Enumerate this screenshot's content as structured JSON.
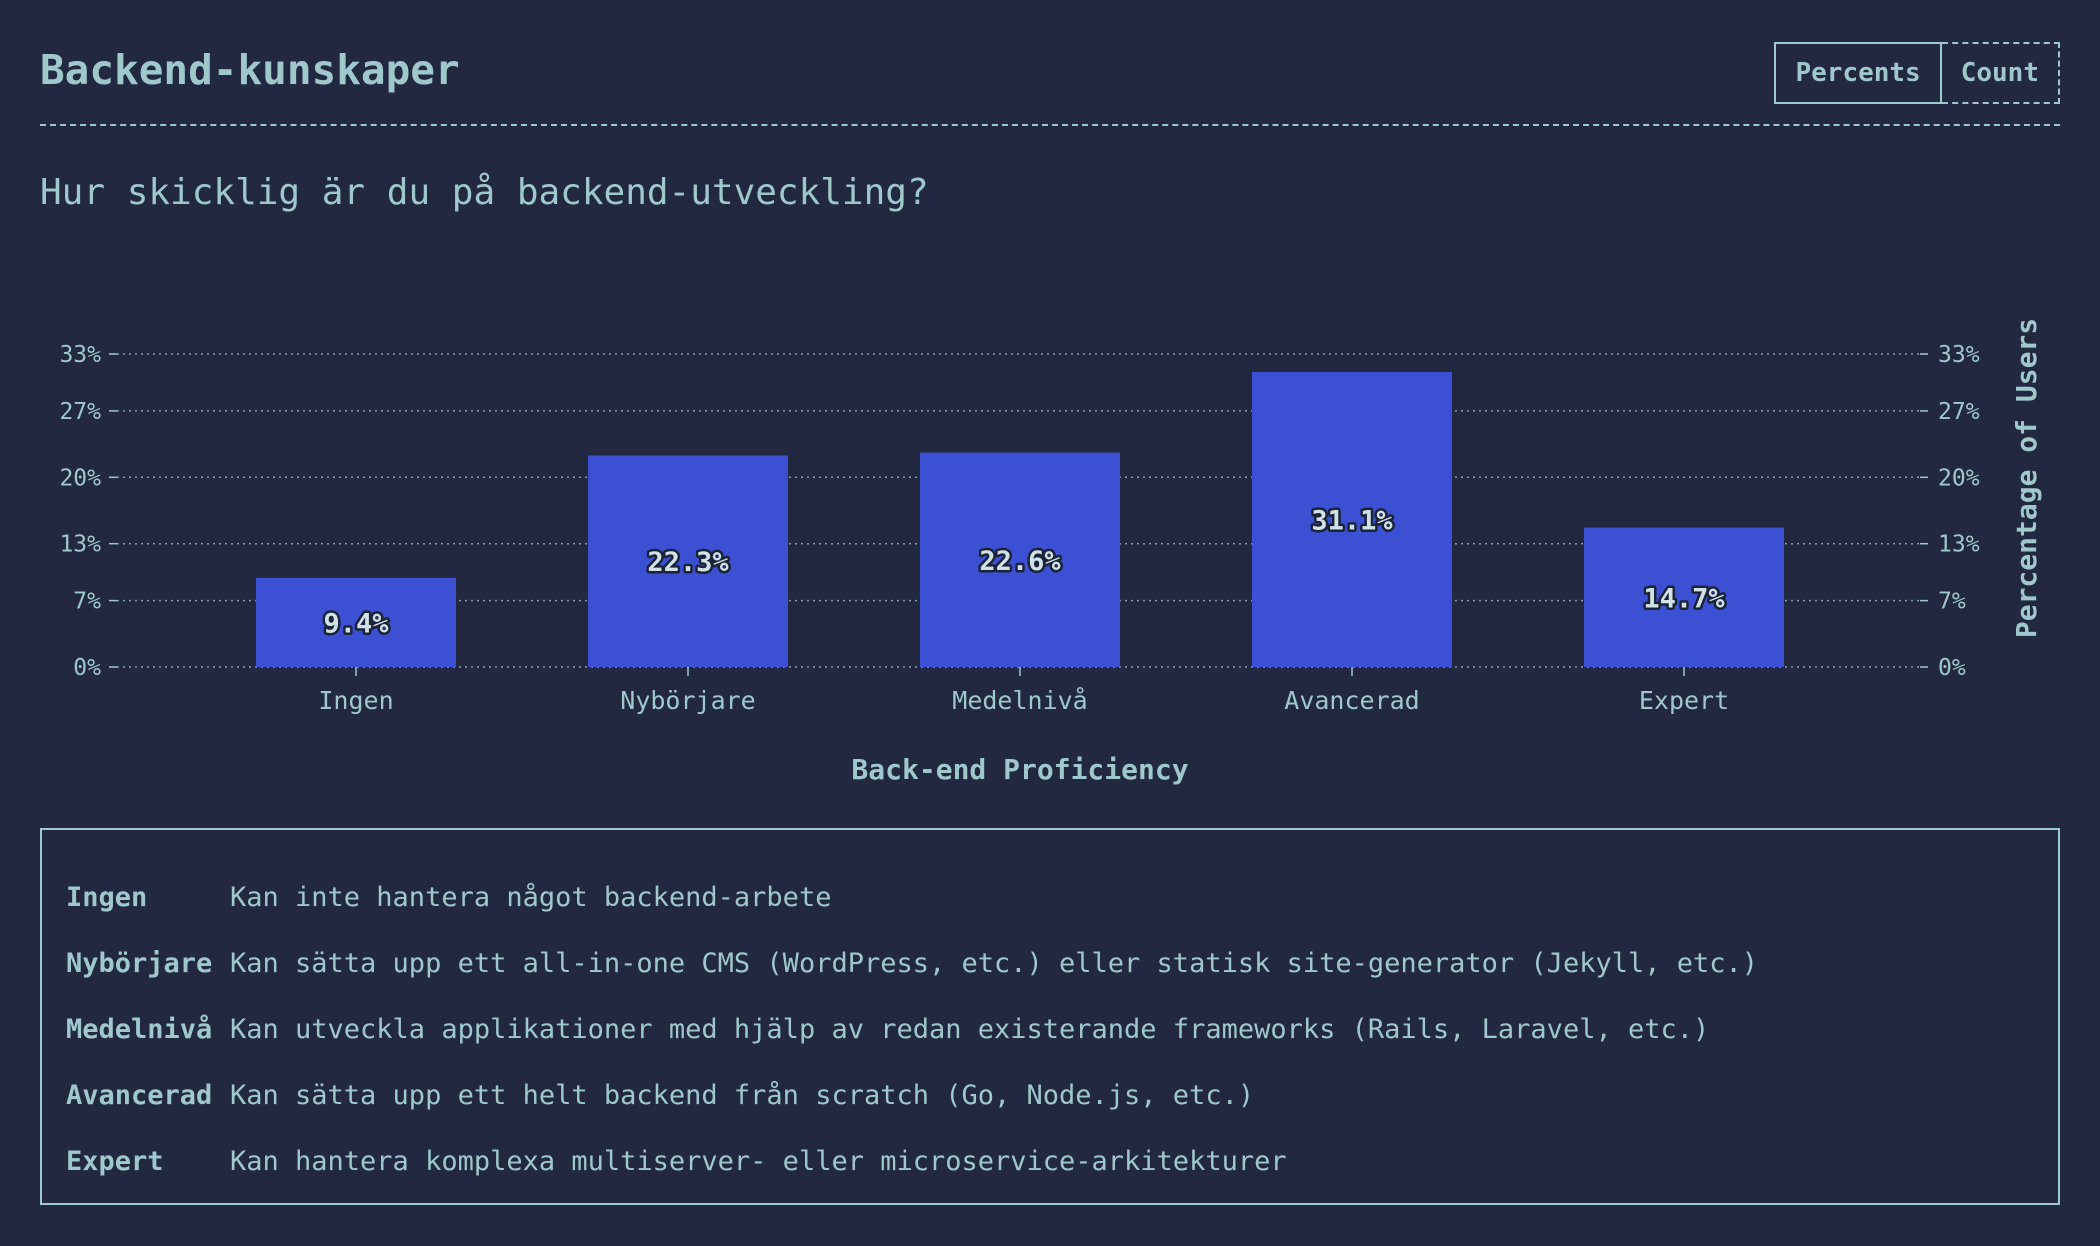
{
  "header": {
    "title": "Backend-kunskaper",
    "toggle": {
      "percents_label": "Percents",
      "count_label": "Count",
      "selected": "Percents"
    }
  },
  "question": "Hur skicklig är du på backend-utveckling?",
  "colors": {
    "background": "#222840",
    "text": "#9fc8cc",
    "bar": "#3c50d4"
  },
  "chart_data": {
    "type": "bar",
    "categories": [
      "Ingen",
      "Nybörjare",
      "Medelnivå",
      "Avancerad",
      "Expert"
    ],
    "values": [
      9.4,
      22.3,
      22.6,
      31.1,
      14.7
    ],
    "value_labels": [
      "9.4%",
      "22.3%",
      "22.6%",
      "31.1%",
      "14.7%"
    ],
    "y_ticks": [
      0,
      7,
      13,
      20,
      27,
      33
    ],
    "y_tick_labels": [
      "0%",
      "7%",
      "13%",
      "20%",
      "27%",
      "33%"
    ],
    "ylim": [
      0,
      33
    ],
    "xlabel": "Back-end Proficiency",
    "ylabel": "Percentage of Users",
    "grid": true
  },
  "legend": {
    "items": [
      {
        "term": "Ingen",
        "description": "Kan inte hantera något backend-arbete"
      },
      {
        "term": "Nybörjare",
        "description": "Kan sätta upp ett all-in-one CMS (WordPress, etc.) eller statisk site-generator (Jekyll, etc.)"
      },
      {
        "term": "Medelnivå",
        "description": "Kan utveckla applikationer med hjälp av redan existerande frameworks (Rails, Laravel, etc.)"
      },
      {
        "term": "Avancerad",
        "description": "Kan sätta upp ett helt backend från scratch (Go, Node.js, etc.)"
      },
      {
        "term": "Expert",
        "description": "Kan hantera komplexa multiserver- eller microservice-arkitekturer"
      }
    ]
  }
}
